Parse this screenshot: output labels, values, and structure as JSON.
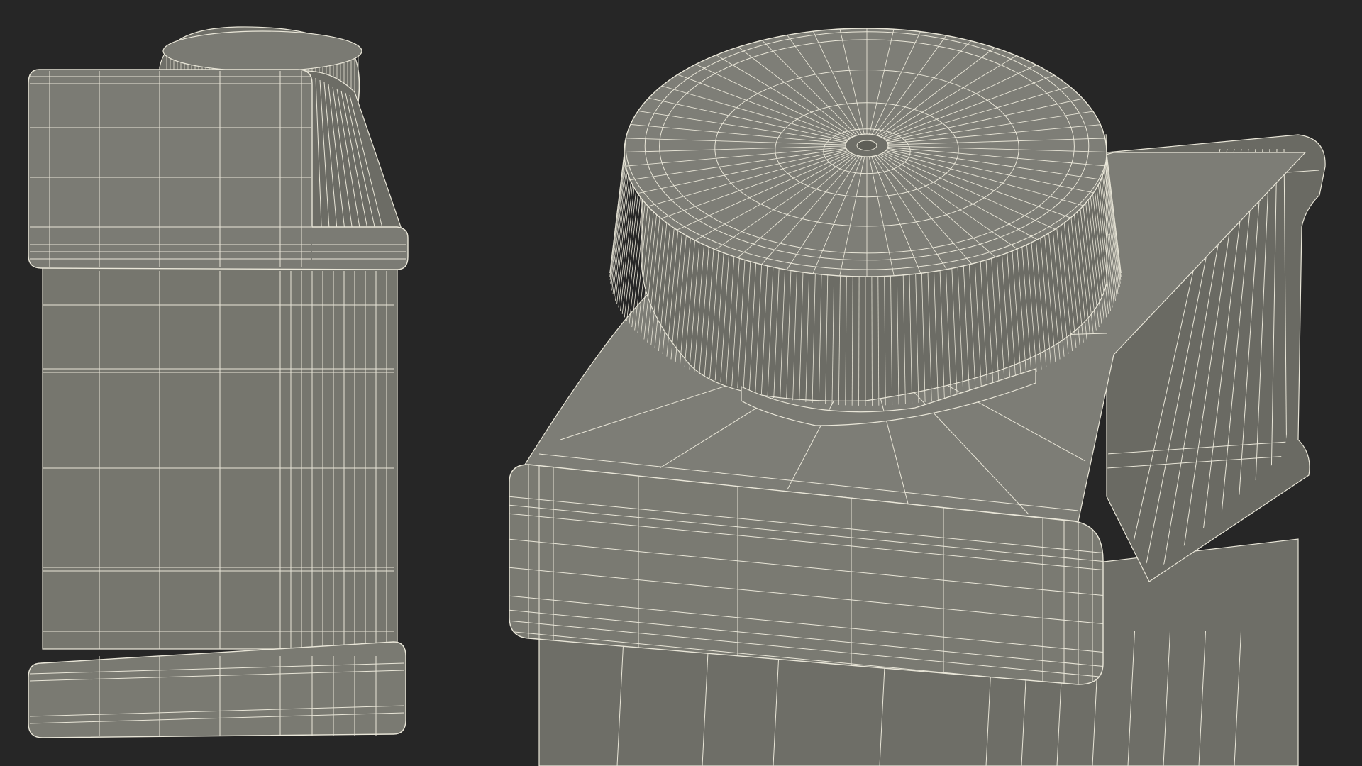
{
  "scene": {
    "background_color": "#262626",
    "surface_color": "#76766e",
    "surface_light_color": "#82827a",
    "surface_dark_color": "#5e5e57",
    "wire_color": "#e9e6d8",
    "views": [
      {
        "name": "left-view",
        "subject": "bottle-side-wireframe"
      },
      {
        "name": "right-view",
        "subject": "bottle-cap-closeup-wireframe"
      }
    ]
  }
}
